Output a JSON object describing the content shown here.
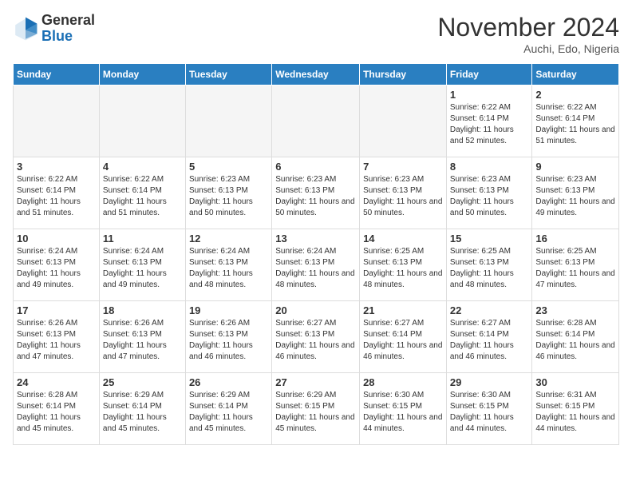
{
  "header": {
    "logo_general": "General",
    "logo_blue": "Blue",
    "month_title": "November 2024",
    "location": "Auchi, Edo, Nigeria"
  },
  "days_of_week": [
    "Sunday",
    "Monday",
    "Tuesday",
    "Wednesday",
    "Thursday",
    "Friday",
    "Saturday"
  ],
  "weeks": [
    [
      {
        "day": "",
        "empty": true
      },
      {
        "day": "",
        "empty": true
      },
      {
        "day": "",
        "empty": true
      },
      {
        "day": "",
        "empty": true
      },
      {
        "day": "",
        "empty": true
      },
      {
        "day": "1",
        "sunrise": "6:22 AM",
        "sunset": "6:14 PM",
        "daylight": "11 hours and 52 minutes."
      },
      {
        "day": "2",
        "sunrise": "6:22 AM",
        "sunset": "6:14 PM",
        "daylight": "11 hours and 51 minutes."
      }
    ],
    [
      {
        "day": "3",
        "sunrise": "6:22 AM",
        "sunset": "6:14 PM",
        "daylight": "11 hours and 51 minutes."
      },
      {
        "day": "4",
        "sunrise": "6:22 AM",
        "sunset": "6:14 PM",
        "daylight": "11 hours and 51 minutes."
      },
      {
        "day": "5",
        "sunrise": "6:23 AM",
        "sunset": "6:13 PM",
        "daylight": "11 hours and 50 minutes."
      },
      {
        "day": "6",
        "sunrise": "6:23 AM",
        "sunset": "6:13 PM",
        "daylight": "11 hours and 50 minutes."
      },
      {
        "day": "7",
        "sunrise": "6:23 AM",
        "sunset": "6:13 PM",
        "daylight": "11 hours and 50 minutes."
      },
      {
        "day": "8",
        "sunrise": "6:23 AM",
        "sunset": "6:13 PM",
        "daylight": "11 hours and 50 minutes."
      },
      {
        "day": "9",
        "sunrise": "6:23 AM",
        "sunset": "6:13 PM",
        "daylight": "11 hours and 49 minutes."
      }
    ],
    [
      {
        "day": "10",
        "sunrise": "6:24 AM",
        "sunset": "6:13 PM",
        "daylight": "11 hours and 49 minutes."
      },
      {
        "day": "11",
        "sunrise": "6:24 AM",
        "sunset": "6:13 PM",
        "daylight": "11 hours and 49 minutes."
      },
      {
        "day": "12",
        "sunrise": "6:24 AM",
        "sunset": "6:13 PM",
        "daylight": "11 hours and 48 minutes."
      },
      {
        "day": "13",
        "sunrise": "6:24 AM",
        "sunset": "6:13 PM",
        "daylight": "11 hours and 48 minutes."
      },
      {
        "day": "14",
        "sunrise": "6:25 AM",
        "sunset": "6:13 PM",
        "daylight": "11 hours and 48 minutes."
      },
      {
        "day": "15",
        "sunrise": "6:25 AM",
        "sunset": "6:13 PM",
        "daylight": "11 hours and 48 minutes."
      },
      {
        "day": "16",
        "sunrise": "6:25 AM",
        "sunset": "6:13 PM",
        "daylight": "11 hours and 47 minutes."
      }
    ],
    [
      {
        "day": "17",
        "sunrise": "6:26 AM",
        "sunset": "6:13 PM",
        "daylight": "11 hours and 47 minutes."
      },
      {
        "day": "18",
        "sunrise": "6:26 AM",
        "sunset": "6:13 PM",
        "daylight": "11 hours and 47 minutes."
      },
      {
        "day": "19",
        "sunrise": "6:26 AM",
        "sunset": "6:13 PM",
        "daylight": "11 hours and 46 minutes."
      },
      {
        "day": "20",
        "sunrise": "6:27 AM",
        "sunset": "6:13 PM",
        "daylight": "11 hours and 46 minutes."
      },
      {
        "day": "21",
        "sunrise": "6:27 AM",
        "sunset": "6:14 PM",
        "daylight": "11 hours and 46 minutes."
      },
      {
        "day": "22",
        "sunrise": "6:27 AM",
        "sunset": "6:14 PM",
        "daylight": "11 hours and 46 minutes."
      },
      {
        "day": "23",
        "sunrise": "6:28 AM",
        "sunset": "6:14 PM",
        "daylight": "11 hours and 46 minutes."
      }
    ],
    [
      {
        "day": "24",
        "sunrise": "6:28 AM",
        "sunset": "6:14 PM",
        "daylight": "11 hours and 45 minutes."
      },
      {
        "day": "25",
        "sunrise": "6:29 AM",
        "sunset": "6:14 PM",
        "daylight": "11 hours and 45 minutes."
      },
      {
        "day": "26",
        "sunrise": "6:29 AM",
        "sunset": "6:14 PM",
        "daylight": "11 hours and 45 minutes."
      },
      {
        "day": "27",
        "sunrise": "6:29 AM",
        "sunset": "6:15 PM",
        "daylight": "11 hours and 45 minutes."
      },
      {
        "day": "28",
        "sunrise": "6:30 AM",
        "sunset": "6:15 PM",
        "daylight": "11 hours and 44 minutes."
      },
      {
        "day": "29",
        "sunrise": "6:30 AM",
        "sunset": "6:15 PM",
        "daylight": "11 hours and 44 minutes."
      },
      {
        "day": "30",
        "sunrise": "6:31 AM",
        "sunset": "6:15 PM",
        "daylight": "11 hours and 44 minutes."
      }
    ]
  ]
}
